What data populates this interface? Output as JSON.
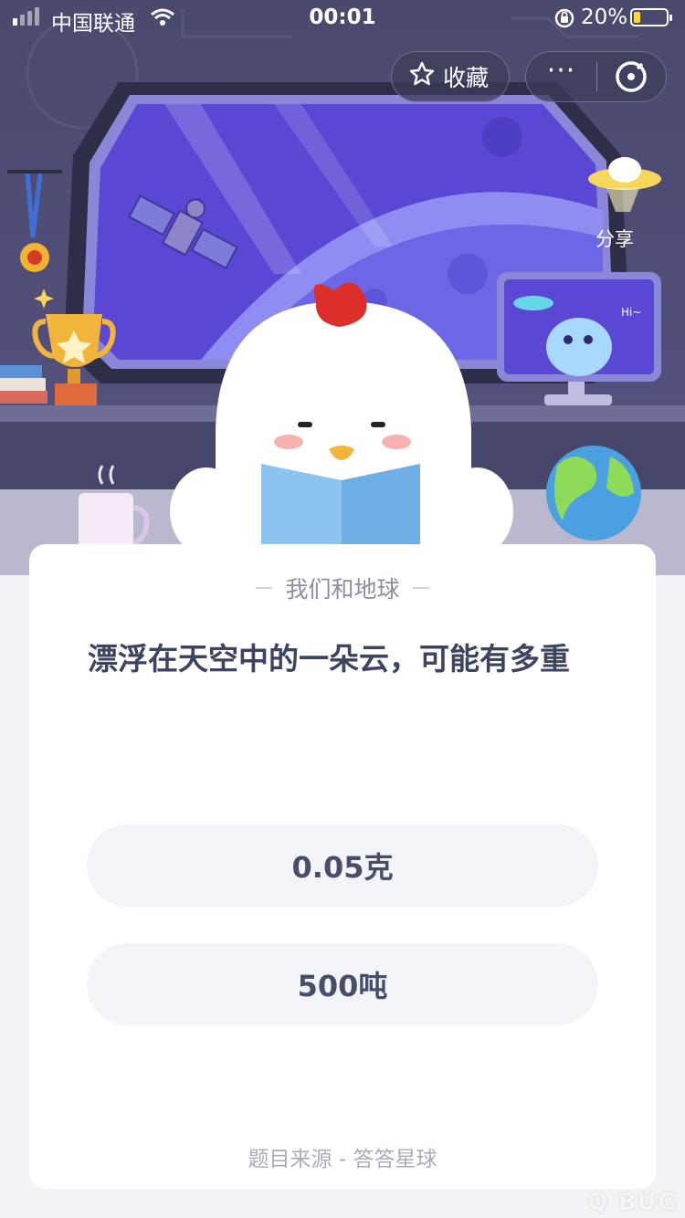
{
  "status_bar": {
    "carrier": "中国联通",
    "time": "00:01",
    "battery_percent": "20%",
    "battery_level": 0.2,
    "battery_color": "#ffd93d"
  },
  "top_actions": {
    "favorite_label": "收藏",
    "favorite_icon": "star-icon",
    "more_icon": "more-dots-icon",
    "close_icon": "close-circle-icon"
  },
  "scene": {
    "share_label": "分享",
    "bubble_text": "Hi~"
  },
  "card": {
    "category": "我们和地球",
    "question": "漂浮在天空中的一朵云，可能有多重",
    "options": [
      "0.05克",
      "500吨"
    ],
    "source": "题目来源 - 答答星球"
  },
  "watermark": "Q BUG"
}
